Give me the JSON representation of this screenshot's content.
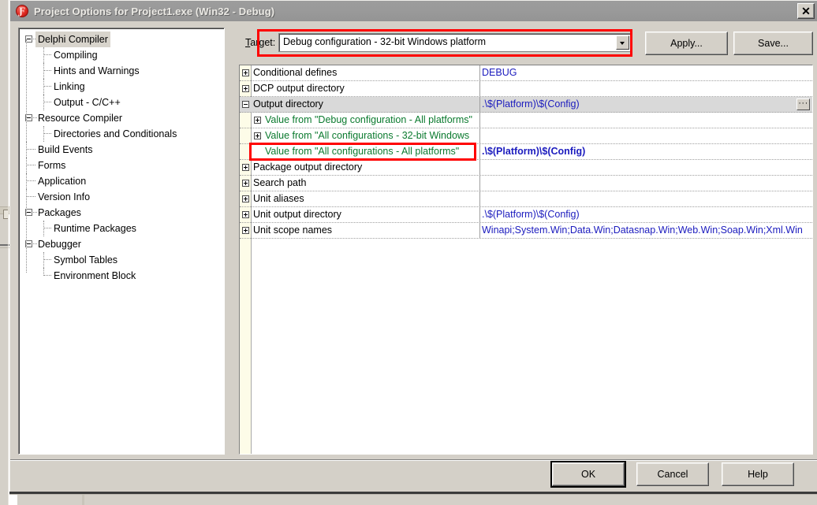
{
  "window": {
    "title": "Project Options for Project1.exe  (Win32 - Debug)",
    "icon": "delphi-app-icon",
    "close_label": "✕"
  },
  "sidebar": {
    "items": [
      {
        "label": "Delphi Compiler",
        "depth": 0,
        "toggle": "minus",
        "selected": true
      },
      {
        "label": "Compiling",
        "depth": 1,
        "toggle": "none",
        "selected": false
      },
      {
        "label": "Hints and Warnings",
        "depth": 1,
        "toggle": "none",
        "selected": false
      },
      {
        "label": "Linking",
        "depth": 1,
        "toggle": "none",
        "selected": false
      },
      {
        "label": "Output - C/C++",
        "depth": 1,
        "toggle": "none",
        "selected": false
      },
      {
        "label": "Resource Compiler",
        "depth": 0,
        "toggle": "minus",
        "selected": false
      },
      {
        "label": "Directories and Conditionals",
        "depth": 1,
        "toggle": "none",
        "selected": false
      },
      {
        "label": "Build Events",
        "depth": 0,
        "toggle": "none",
        "selected": false
      },
      {
        "label": "Forms",
        "depth": 0,
        "toggle": "none",
        "selected": false
      },
      {
        "label": "Application",
        "depth": 0,
        "toggle": "none",
        "selected": false
      },
      {
        "label": "Version Info",
        "depth": 0,
        "toggle": "none",
        "selected": false
      },
      {
        "label": "Packages",
        "depth": 0,
        "toggle": "minus",
        "selected": false
      },
      {
        "label": "Runtime Packages",
        "depth": 1,
        "toggle": "none",
        "selected": false
      },
      {
        "label": "Debugger",
        "depth": 0,
        "toggle": "minus",
        "selected": false
      },
      {
        "label": "Symbol Tables",
        "depth": 1,
        "toggle": "none",
        "selected": false
      },
      {
        "label": "Environment Block",
        "depth": 1,
        "toggle": "none",
        "selected": false
      }
    ]
  },
  "target": {
    "label": "Target:",
    "label_accel": "T",
    "label_rest": "arget:",
    "value": "Debug configuration - 32-bit Windows platform",
    "dropdown_icon": "chevron-down-icon",
    "highlight_color": "#ff0000"
  },
  "toolbar": {
    "apply_label": "Apply...",
    "save_label": "Save..."
  },
  "grid": {
    "ellipsis_label": "···",
    "rows": [
      {
        "name": "Conditional defines",
        "value": "DEBUG",
        "toggle": "plus",
        "depth": 0,
        "selected": false,
        "inherited": false,
        "bold": false,
        "ellipsis": false
      },
      {
        "name": "DCP output directory",
        "value": "",
        "toggle": "plus",
        "depth": 0,
        "selected": false,
        "inherited": false,
        "bold": false,
        "ellipsis": false
      },
      {
        "name": "Output directory",
        "value": ".\\$(Platform)\\$(Config)",
        "toggle": "minus",
        "depth": 0,
        "selected": true,
        "inherited": false,
        "bold": false,
        "ellipsis": true
      },
      {
        "name": "Value from \"Debug configuration - All platforms\"",
        "value": "",
        "toggle": "plus",
        "depth": 1,
        "selected": false,
        "inherited": true,
        "bold": false,
        "ellipsis": false
      },
      {
        "name": "Value from \"All configurations - 32-bit Windows",
        "value": "",
        "toggle": "plus",
        "depth": 1,
        "selected": false,
        "inherited": true,
        "bold": false,
        "ellipsis": false
      },
      {
        "name": "Value from \"All configurations - All platforms\"",
        "value": ".\\$(Platform)\\$(Config)",
        "toggle": "none",
        "depth": 1,
        "selected": false,
        "inherited": true,
        "bold": true,
        "ellipsis": false
      },
      {
        "name": "Package output directory",
        "value": "",
        "toggle": "plus",
        "depth": 0,
        "selected": false,
        "inherited": false,
        "bold": false,
        "ellipsis": false
      },
      {
        "name": "Search path",
        "value": "",
        "toggle": "plus",
        "depth": 0,
        "selected": false,
        "inherited": false,
        "bold": false,
        "ellipsis": false
      },
      {
        "name": "Unit aliases",
        "value": "",
        "toggle": "plus",
        "depth": 0,
        "selected": false,
        "inherited": false,
        "bold": false,
        "ellipsis": false
      },
      {
        "name": "Unit output directory",
        "value": ".\\$(Platform)\\$(Config)",
        "toggle": "plus",
        "depth": 0,
        "selected": false,
        "inherited": false,
        "bold": false,
        "ellipsis": false
      },
      {
        "name": "Unit scope names",
        "value": "Winapi;System.Win;Data.Win;Datasnap.Win;Web.Win;Soap.Win;Xml.Win",
        "toggle": "plus",
        "depth": 0,
        "selected": false,
        "inherited": false,
        "bold": false,
        "ellipsis": false
      }
    ]
  },
  "footer": {
    "ok_label": "OK",
    "cancel_label": "Cancel",
    "help_label": "Help"
  },
  "colors": {
    "dialog_face": "#d4d0c8",
    "titlebar": "#9a9a9a",
    "value_text": "#1b1bbe",
    "inherited_text": "#0a7a2e",
    "selected_row": "#d9d9d9",
    "annotation": "#ff0000",
    "gutter": "#fdfce8"
  }
}
